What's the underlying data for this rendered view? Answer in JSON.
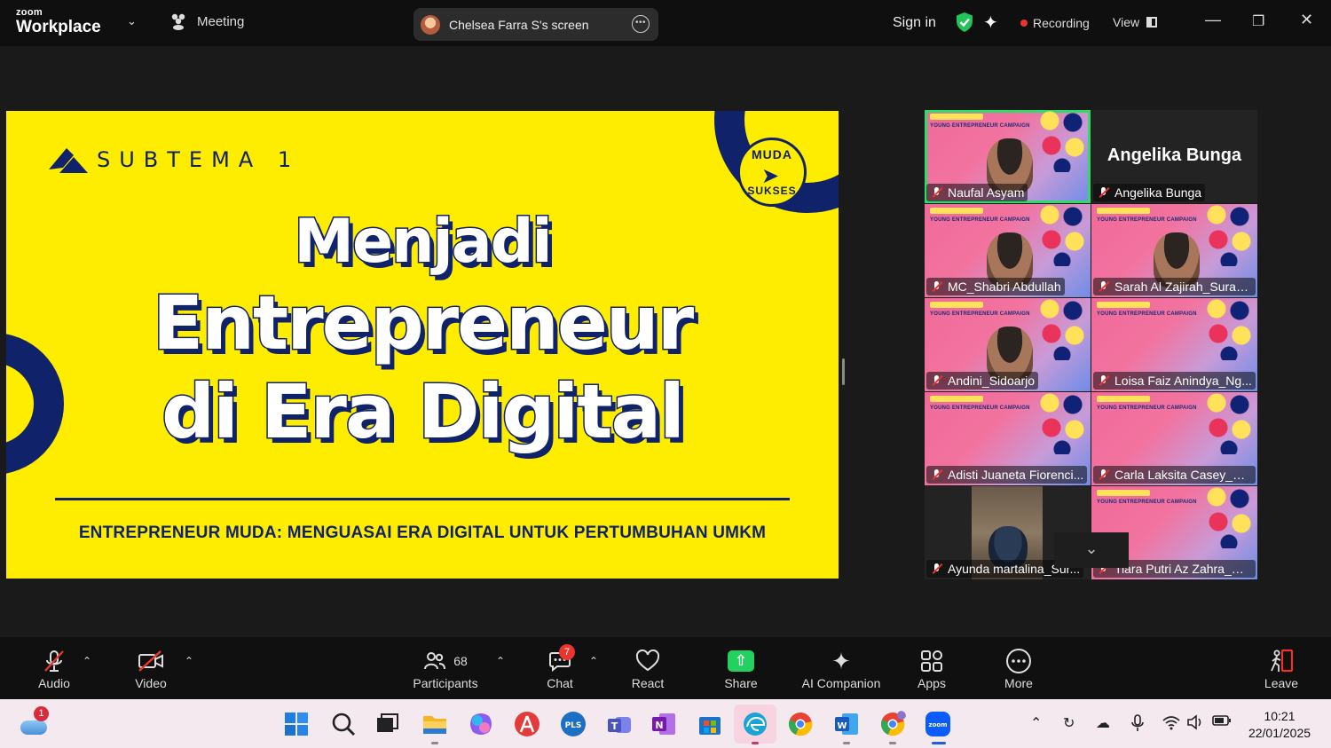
{
  "titlebar": {
    "brand_small": "zoom",
    "brand_large": "Workplace",
    "meeting_label": "Meeting",
    "screen_share_label": "Chelsea Farra S's screen",
    "sign_in": "Sign in",
    "recording": "Recording",
    "view": "View"
  },
  "slide": {
    "subtema": "SUBTEMA 1",
    "badge_top": "MUDA",
    "badge_bottom": "SUKSES",
    "line1": "Menjadi",
    "line2": "Entrepreneur",
    "line3": "di Era Digital",
    "subtitle": "ENTREPRENEUR MUDA: MENGUASAI ERA DIGITAL UNTUK PERTUMBUHAN UMKM"
  },
  "gallery": {
    "banner_text": "YOUNG ENTREPRENEUR CAMPAIGN",
    "participants": [
      {
        "name": "Naufal Asyam",
        "kind": "video",
        "active": true
      },
      {
        "name": "Angelika Bunga",
        "kind": "name-only",
        "display": "Angelika Bunga"
      },
      {
        "name": "MC_Shabri Abdullah",
        "kind": "video"
      },
      {
        "name": "Sarah Al Zajirah_Surab...",
        "kind": "video"
      },
      {
        "name": "Andini_Sidoarjo",
        "kind": "video"
      },
      {
        "name": "Loisa Faiz Anindya_Ng...",
        "kind": "video"
      },
      {
        "name": "Adisti Juaneta Fiorenci...",
        "kind": "video"
      },
      {
        "name": "Carla Laksita Casey_DIY",
        "kind": "video"
      },
      {
        "name": "Ayunda martalina_Sur...",
        "kind": "photo"
      },
      {
        "name": "Tiara Putri Az Zahra_Si...",
        "kind": "video"
      }
    ]
  },
  "toolbar": {
    "audio": "Audio",
    "video": "Video",
    "participants": "Participants",
    "participant_count": "68",
    "chat": "Chat",
    "chat_badge": "7",
    "react": "React",
    "share": "Share",
    "ai_companion": "AI Companion",
    "apps": "Apps",
    "more": "More",
    "leave": "Leave"
  },
  "taskbar": {
    "weather_badge": "1",
    "time": "10:21",
    "date": "22/01/2025"
  },
  "colors": {
    "slide_yellow": "#ffed00",
    "slide_navy": "#10226a",
    "active_speaker": "#2edb6b",
    "share_green": "#23d160",
    "alert_red": "#e8352e"
  }
}
